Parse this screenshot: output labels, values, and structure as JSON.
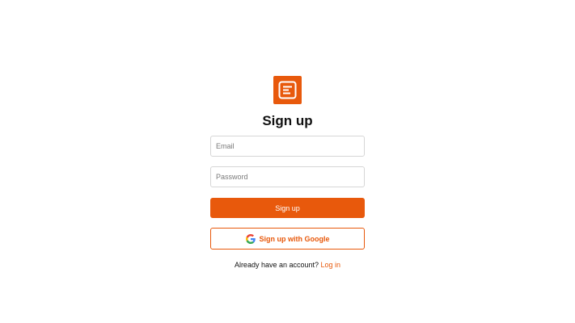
{
  "app": {
    "logo_icon": "document-lines-icon",
    "accent_color": "#e8590c"
  },
  "form": {
    "title": "Sign up",
    "email_placeholder": "Email",
    "password_placeholder": "Password",
    "submit_label": "Sign up",
    "google_label": "Sign up with Google",
    "google_icon": "google-icon"
  },
  "footer": {
    "prompt": "Already have an account?",
    "login_label": "Log in"
  }
}
